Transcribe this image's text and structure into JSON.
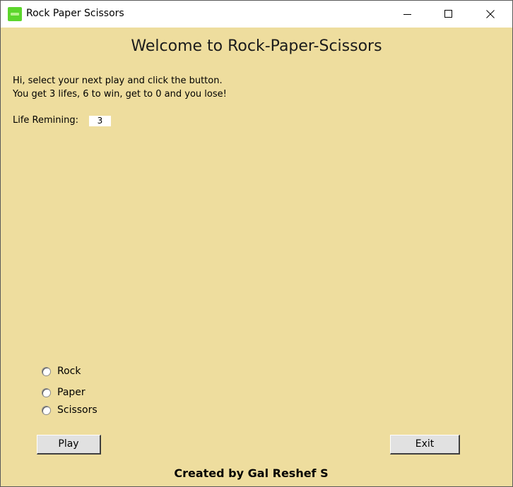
{
  "window": {
    "title": "Rock Paper Scissors",
    "icon": "app-icon"
  },
  "header": {
    "welcome": "Welcome to Rock-Paper-Scissors"
  },
  "intro": {
    "line1": "Hi, select your next play and click the button.",
    "line2": "You get 3 lifes, 6 to win, get to 0  and you lose!"
  },
  "life": {
    "label": "Life Remining:",
    "value": "3"
  },
  "choices": {
    "rock": "Rock",
    "paper": "Paper",
    "scissors": "Scissors"
  },
  "buttons": {
    "play": "Play",
    "exit": "Exit"
  },
  "footer": {
    "credit": "Created by Gal Reshef S"
  },
  "colors": {
    "background": "#EEDD9E",
    "titlebar": "#ffffff",
    "icon": "#5cd62c"
  }
}
